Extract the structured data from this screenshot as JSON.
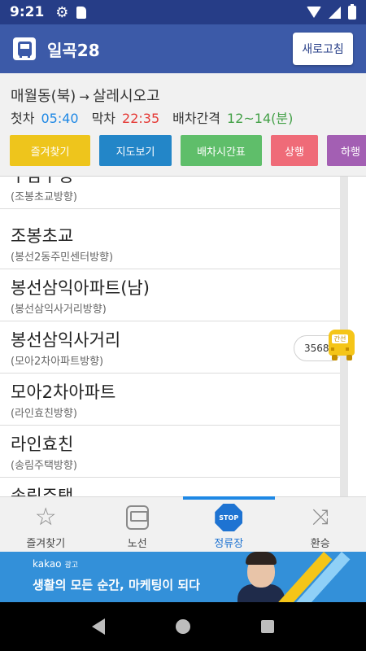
{
  "status_bar": {
    "time": "9:21"
  },
  "header": {
    "title": "일곡28",
    "refresh_label": "새로고침"
  },
  "route": {
    "from": "매월동(북)",
    "arrow": "→",
    "to": "살레시오고",
    "first_label": "첫차",
    "first_time": "05:40",
    "last_label": "막차",
    "last_time": "22:35",
    "interval_label": "배차간격",
    "interval_value": "12~14(분)"
  },
  "actions": {
    "favorite": "즐겨찾기",
    "map": "지도보기",
    "timetable": "배차시간표",
    "up": "상행",
    "down": "하행"
  },
  "stops": [
    {
      "name": "구남구정",
      "direction": "(조봉초교방향)"
    },
    {
      "name": "조봉초교",
      "direction": "(봉선2동주민센터방향)"
    },
    {
      "name": "봉선삼익아파트(남)",
      "direction": "(봉선삼익사거리방향)"
    },
    {
      "name": "봉선삼익사거리",
      "direction": "(모아2차아파트방향)"
    },
    {
      "name": "모아2차아파트",
      "direction": "(라인효친방향)"
    },
    {
      "name": "라인효친",
      "direction": "(송림주택방향)"
    },
    {
      "name": "송림주택",
      "direction": ""
    }
  ],
  "bus": {
    "plate": "3568",
    "type_label": "간선"
  },
  "tabs": [
    {
      "label": "즐겨찾기",
      "icon": "star-icon"
    },
    {
      "label": "노선",
      "icon": "bus-icon"
    },
    {
      "label": "정류장",
      "icon": "stop-sign-icon",
      "badge": "STOP"
    },
    {
      "label": "환승",
      "icon": "transfer-icon"
    }
  ],
  "ad": {
    "brand": "kakao",
    "tag": "광고",
    "copy": "생활의 모든 순간, 마케팅이 되다"
  },
  "colors": {
    "status_bar": "#263d87",
    "header": "#3c5aa8",
    "first_time": "#1e88e5",
    "last_time": "#e53935",
    "interval": "#43a047",
    "favorite_btn": "#eec51c",
    "map_btn": "#2386c8",
    "timetable_btn": "#5fbe6a",
    "up_btn": "#ef6b78",
    "down_btn": "#a35fb3",
    "active_tab": "#1e73d2",
    "ad_bg": "#3390d9",
    "bus_marker": "#f5c518"
  }
}
